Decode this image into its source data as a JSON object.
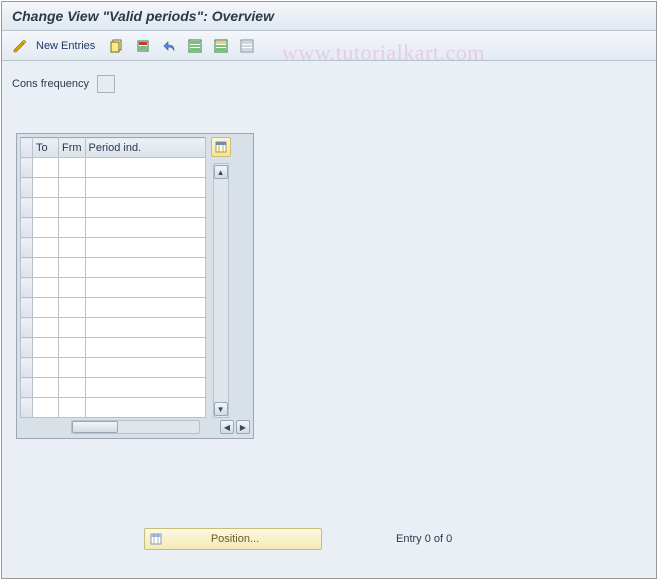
{
  "title": "Change View \"Valid periods\": Overview",
  "toolbar": {
    "new_entries_label": "New Entries"
  },
  "watermark": "www.tutorialkart.com",
  "field": {
    "cons_frequency_label": "Cons frequency",
    "cons_frequency_value": ""
  },
  "table": {
    "columns": {
      "to": "To",
      "frm": "Frm",
      "period_ind": "Period ind."
    },
    "rows": [
      {
        "to": "",
        "frm": "",
        "period": ""
      },
      {
        "to": "",
        "frm": "",
        "period": ""
      },
      {
        "to": "",
        "frm": "",
        "period": ""
      },
      {
        "to": "",
        "frm": "",
        "period": ""
      },
      {
        "to": "",
        "frm": "",
        "period": ""
      },
      {
        "to": "",
        "frm": "",
        "period": ""
      },
      {
        "to": "",
        "frm": "",
        "period": ""
      },
      {
        "to": "",
        "frm": "",
        "period": ""
      },
      {
        "to": "",
        "frm": "",
        "period": ""
      },
      {
        "to": "",
        "frm": "",
        "period": ""
      },
      {
        "to": "",
        "frm": "",
        "period": ""
      },
      {
        "to": "",
        "frm": "",
        "period": ""
      },
      {
        "to": "",
        "frm": "",
        "period": ""
      }
    ]
  },
  "footer": {
    "position_label": "Position...",
    "entry_status": "Entry 0 of 0"
  },
  "colors": {
    "bg": "#eaeff5",
    "accent": "#f3e9b6"
  }
}
